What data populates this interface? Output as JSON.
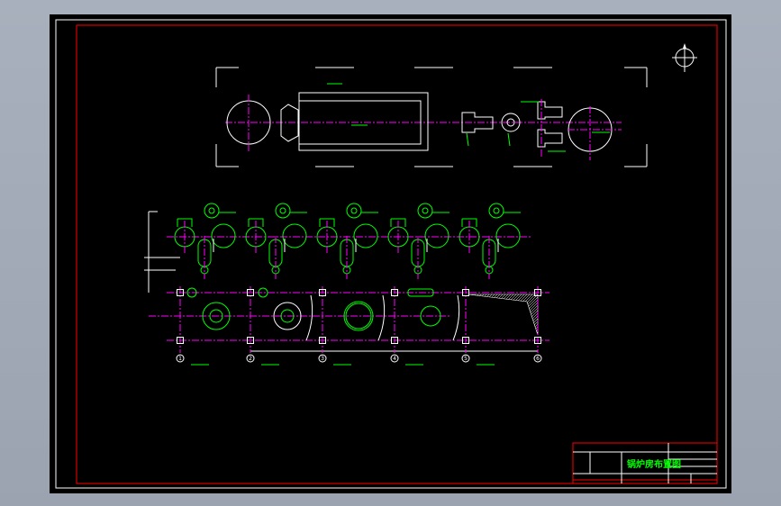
{
  "drawing": {
    "title": "锅炉房布置图",
    "axis_labels": [
      "1",
      "2",
      "3",
      "4",
      "5",
      "6"
    ],
    "colors": {
      "background": "#000000",
      "frame": "#ff0000",
      "centerline": "#ff00ff",
      "equipment": "#00ff00",
      "lines": "#ffffff"
    }
  }
}
